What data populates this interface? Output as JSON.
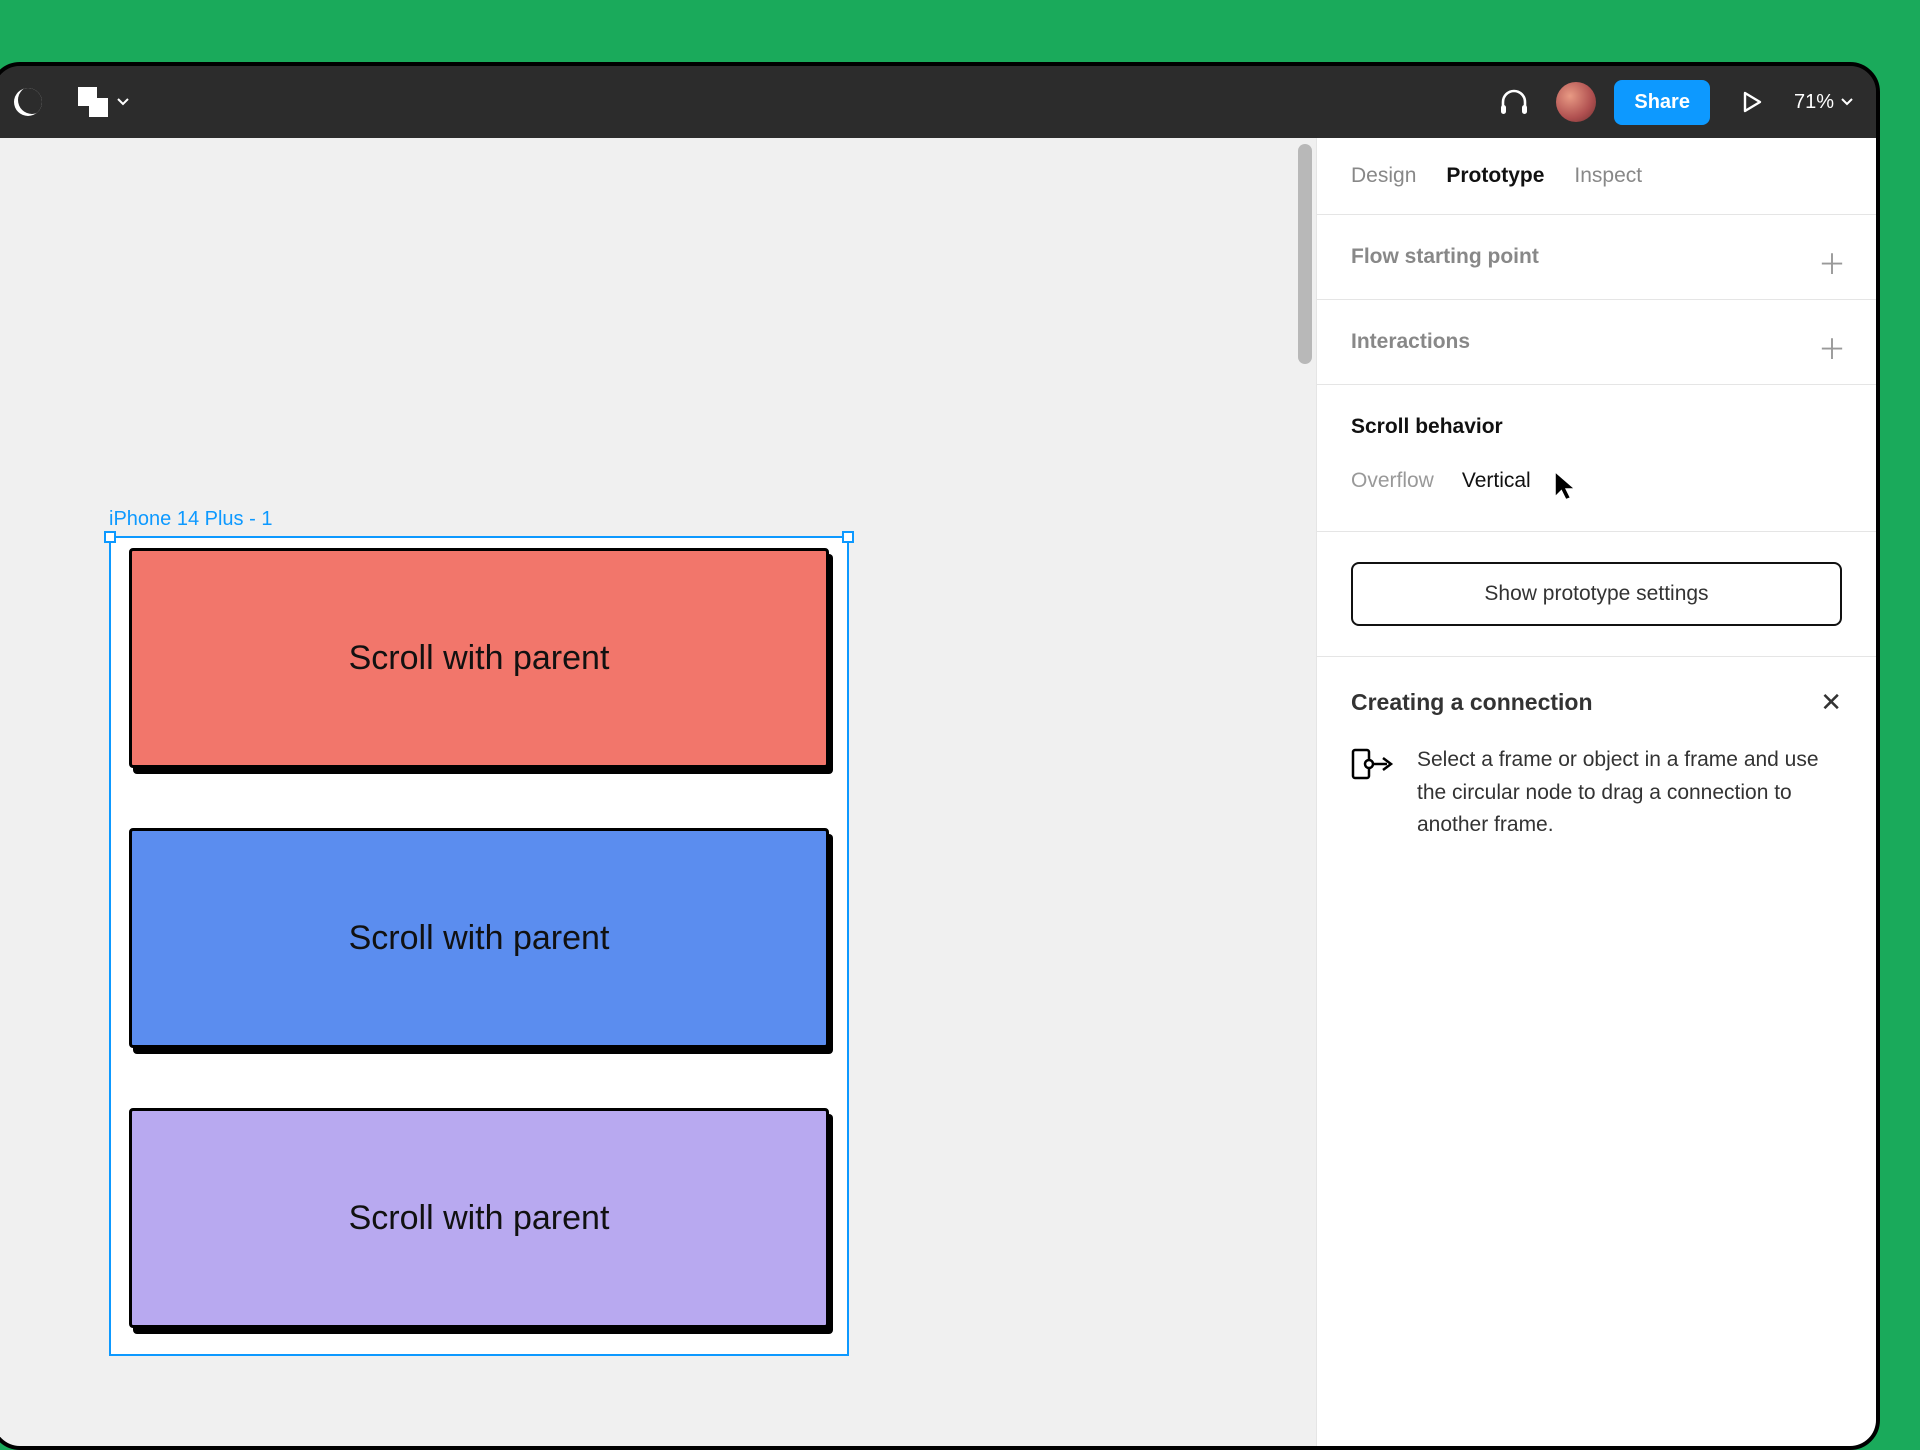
{
  "toolbar": {
    "share_label": "Share",
    "zoom_label": "71%"
  },
  "tabs": {
    "design": "Design",
    "prototype": "Prototype",
    "inspect": "Inspect"
  },
  "sections": {
    "flow_title": "Flow starting point",
    "interactions_title": "Interactions",
    "scroll_title": "Scroll behavior",
    "overflow_label": "Overflow",
    "overflow_value": "Vertical",
    "proto_settings_btn": "Show prototype settings"
  },
  "hint": {
    "title": "Creating a connection",
    "body": "Select a frame or object in a frame and use the circular node to drag a connection to another frame."
  },
  "canvas": {
    "frame_name": "iPhone 14 Plus - 1",
    "card_label": "Scroll with parent"
  }
}
